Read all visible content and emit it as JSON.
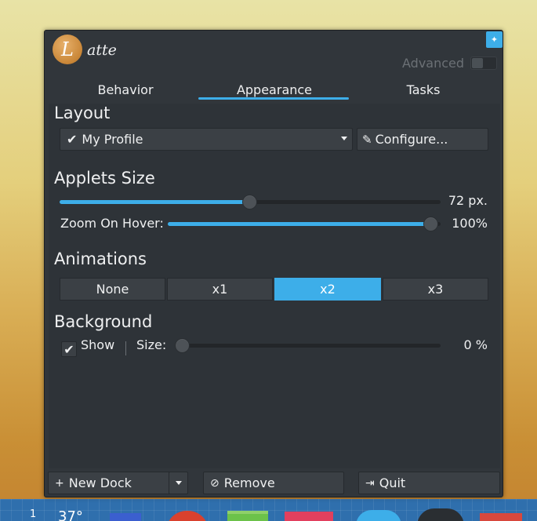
{
  "app": {
    "logo_letter": "L",
    "logo_text": "atte"
  },
  "header": {
    "advanced_label": "Advanced",
    "advanced_enabled": false
  },
  "tabs": [
    {
      "label": "Behavior",
      "active": false
    },
    {
      "label": "Appearance",
      "active": true
    },
    {
      "label": "Tasks",
      "active": false
    }
  ],
  "layout": {
    "title": "Layout",
    "profile_check": "✔",
    "profile_value": "My Profile",
    "configure_label": "Configure..."
  },
  "applets": {
    "title": "Applets Size",
    "size_value": "72 px.",
    "size_fraction": 0.5,
    "zoom_label": "Zoom On Hover:",
    "zoom_value": "100%",
    "zoom_fraction": 1.0
  },
  "animations": {
    "title": "Animations",
    "options": [
      "None",
      "x1",
      "x2",
      "x3"
    ],
    "selected": "x2"
  },
  "background": {
    "title": "Background",
    "show_label": "Show",
    "show_checked": true,
    "size_label": "Size:",
    "size_value": "0 %",
    "size_fraction": 0
  },
  "footer": {
    "new_dock_label": "New Dock",
    "remove_label": "Remove",
    "quit_label": "Quit"
  },
  "dock": {
    "workspace_number": "1",
    "temperature": "37°"
  },
  "colors": {
    "accent": "#3daee9",
    "window_bg": "#31363b",
    "button_bg": "#3b4045",
    "text": "#eff0f1"
  },
  "icons": {
    "pin": "pin-icon",
    "check": "checkmark-icon",
    "configure": "pencil-icon",
    "new_dock": "plus-icon",
    "remove": "remove-icon",
    "quit": "quit-icon"
  }
}
